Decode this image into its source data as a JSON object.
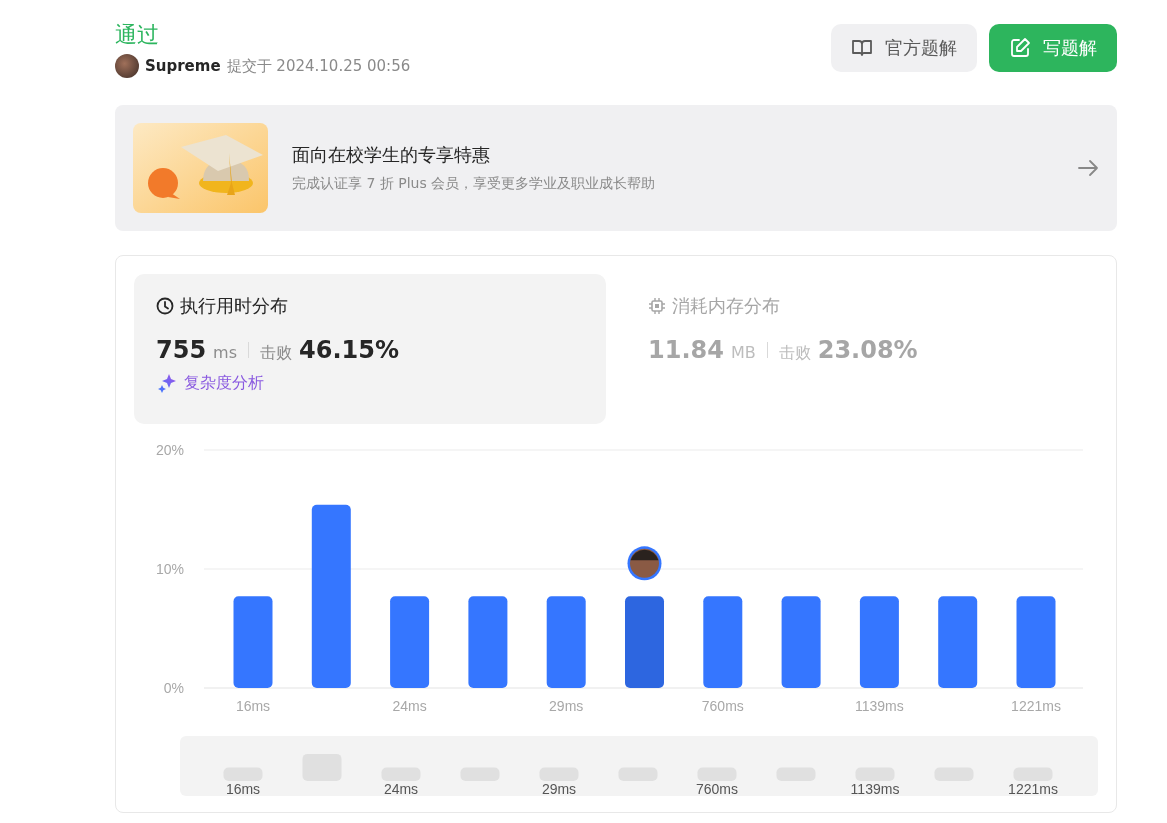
{
  "header": {
    "status": "通过",
    "user": "Supreme",
    "submitted": "提交于 2024.10.25 00:56"
  },
  "actions": [
    {
      "kind": "secondary",
      "label": "官方题解"
    },
    {
      "kind": "primary",
      "label": "写题解"
    }
  ],
  "promo": {
    "title": "面向在校学生的专享特惠",
    "subtitle": "完成认证享 7 折 Plus 会员，享受更多学业及职业成长帮助"
  },
  "stats": [
    {
      "kind": "time",
      "title": "执行用时分布",
      "value": "755",
      "unit": "ms",
      "beat_label": "击败",
      "beat_value": "46.15%",
      "link": "复杂度分析",
      "selected": true
    },
    {
      "kind": "memory",
      "title": "消耗内存分布",
      "value": "11.84",
      "unit": "MB",
      "beat_label": "击败",
      "beat_value": "23.08%",
      "selected": false
    }
  ],
  "chart": {
    "chart_data": {
      "type": "bar",
      "categories": [
        "16ms",
        null,
        "24ms",
        null,
        "29ms",
        null,
        "760ms",
        null,
        "1139ms",
        null,
        "1221ms"
      ],
      "values": [
        7.7,
        15.4,
        7.7,
        7.7,
        7.7,
        7.7,
        7.7,
        7.7,
        7.7,
        7.7,
        7.7
      ],
      "ylim": [
        0,
        20
      ],
      "yticks": [
        {
          "value": 0,
          "label": "0%"
        },
        {
          "value": 10,
          "label": "10%"
        },
        {
          "value": 20,
          "label": "20%"
        }
      ]
    },
    "bars": [
      {
        "selected": false
      },
      {
        "selected": false
      },
      {
        "selected": false
      },
      {
        "selected": false
      },
      {
        "selected": false
      },
      {
        "selected": true
      },
      {
        "selected": false
      },
      {
        "selected": false
      },
      {
        "selected": false
      },
      {
        "selected": false
      },
      {
        "selected": false
      }
    ],
    "overview_labels": [
      "16ms",
      "24ms",
      "29ms",
      "760ms",
      "1139ms",
      "1221ms"
    ]
  }
}
